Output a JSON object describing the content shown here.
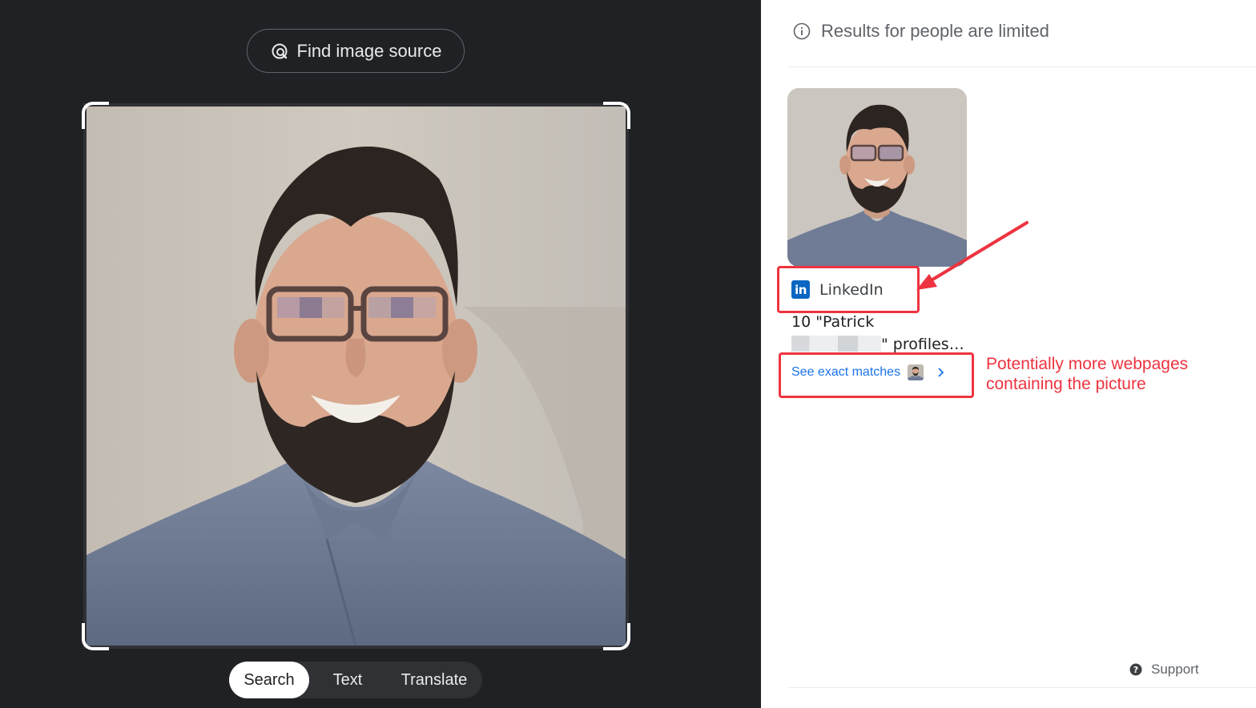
{
  "lens": {
    "find_source_label": "Find image source",
    "mode_tabs": [
      {
        "label": "Search",
        "selected": true
      },
      {
        "label": "Text",
        "selected": false
      },
      {
        "label": "Translate",
        "selected": false
      }
    ]
  },
  "results": {
    "notice": "Results for people are limited",
    "card": {
      "source_name": "LinkedIn",
      "source_icon_text": "in",
      "title_line1": "10 \"Patrick",
      "title_line2_suffix": "\" profiles…",
      "link_label": "See exact matches"
    },
    "annotation": "Potentially more webpages containing the picture",
    "support_label": "Support"
  },
  "colors": {
    "annotation_red": "#ee3340",
    "link_blue": "#1a73e8",
    "linkedin_blue": "#0a66c2",
    "dark_bg": "#202124"
  },
  "icons": {
    "find_source": "lens-search-icon",
    "notice": "info-icon",
    "source": "linkedin-icon",
    "link_chevron": "chevron-right-icon",
    "support": "help-icon"
  }
}
